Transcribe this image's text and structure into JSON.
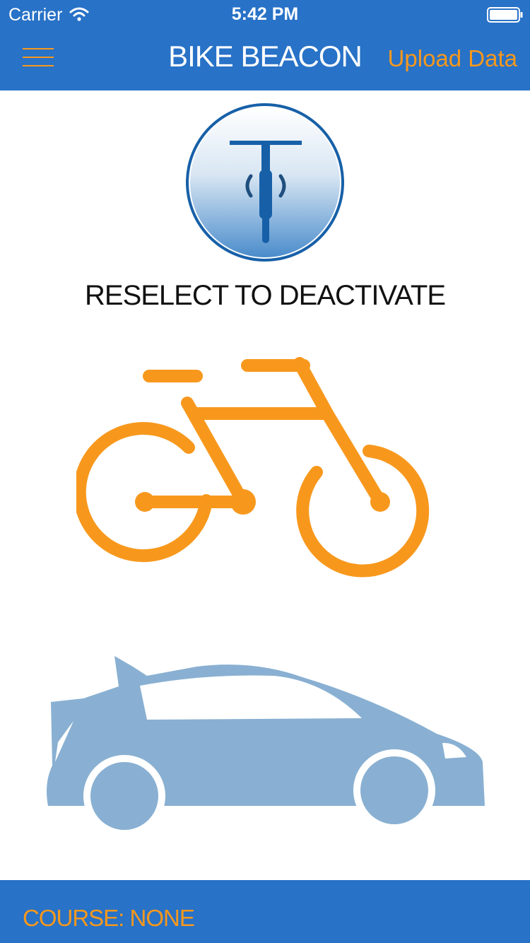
{
  "status": {
    "carrier": "Carrier",
    "time": "5:42 PM"
  },
  "header": {
    "title": "BIKE BEACON",
    "upload_label": "Upload Data"
  },
  "beacon": {
    "caption": "RESELECT TO DEACTIVATE"
  },
  "footer": {
    "course_text": "COURSE: NONE"
  },
  "icons": {
    "menu": "hamburger-menu-icon",
    "beacon": "bike-beacon-icon",
    "bike": "bicycle-icon",
    "car": "car-icon"
  },
  "colors": {
    "header_blue": "#2872c7",
    "accent_orange": "#f7981d",
    "car_blue": "#89b0d2",
    "beacon_dark_blue": "#1760a8"
  }
}
